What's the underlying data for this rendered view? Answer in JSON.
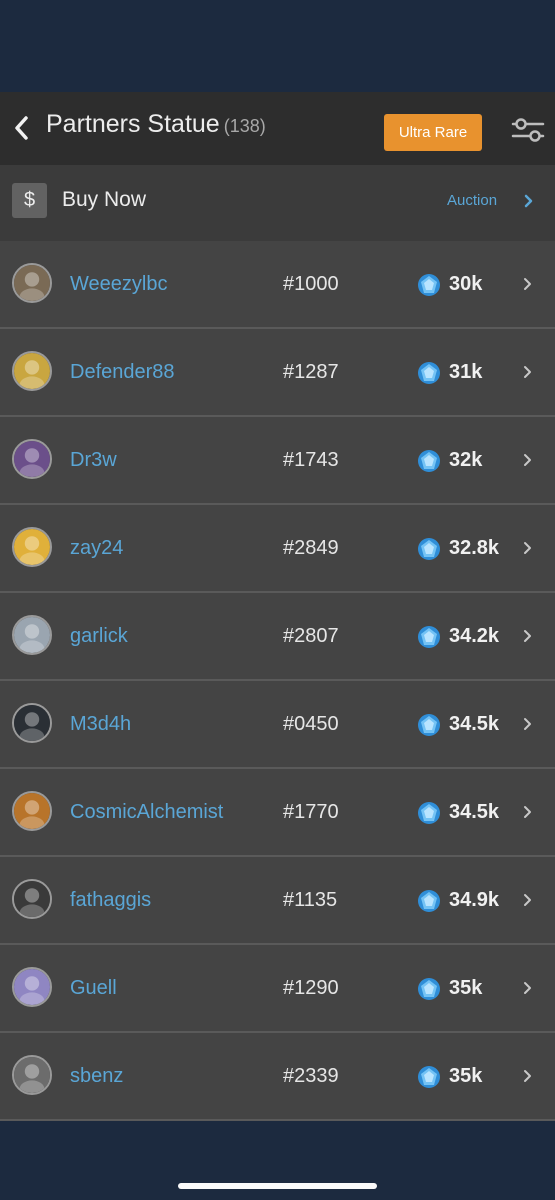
{
  "header": {
    "title": "Partners Statue",
    "count": "(138)",
    "rarity_button": "Ultra Rare",
    "back_icon": "chevron-left-icon",
    "filter_icon": "sliders-icon"
  },
  "subbar": {
    "currency_symbol": "$",
    "mode": "Buy Now",
    "alternate_mode": "Auction"
  },
  "colors": {
    "accent_orange": "#e8922e",
    "link_blue": "#5aa6d6",
    "header_bg": "#2d2d2d",
    "row_bg": "#444444",
    "page_bg": "#1c2a3f"
  },
  "listings": [
    {
      "user": "Weeezylbc",
      "serial": "#1000",
      "price": "30k"
    },
    {
      "user": "Defender88",
      "serial": "#1287",
      "price": "31k"
    },
    {
      "user": "Dr3w",
      "serial": "#1743",
      "price": "32k"
    },
    {
      "user": "zay24",
      "serial": "#2849",
      "price": "32.8k"
    },
    {
      "user": "garlick",
      "serial": "#2807",
      "price": "34.2k"
    },
    {
      "user": "M3d4h",
      "serial": "#0450",
      "price": "34.5k"
    },
    {
      "user": "CosmicAlchemist",
      "serial": "#1770",
      "price": "34.5k"
    },
    {
      "user": "fathaggis",
      "serial": "#1135",
      "price": "34.9k"
    },
    {
      "user": "Guell",
      "serial": "#1290",
      "price": "35k"
    },
    {
      "user": "sbenz",
      "serial": "#2339",
      "price": "35k"
    }
  ]
}
